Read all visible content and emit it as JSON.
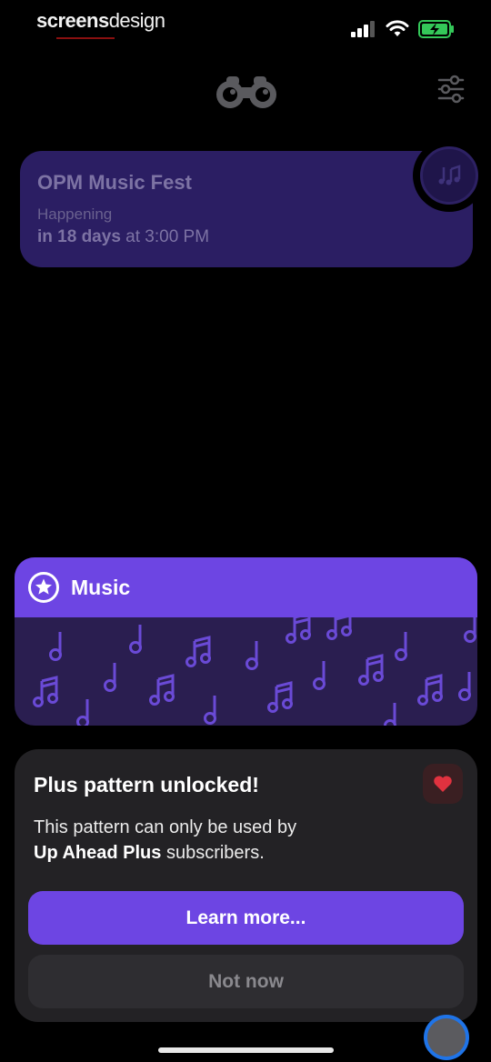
{
  "status_bar": {
    "brand_part1": "screens",
    "brand_part2": "design",
    "icons": [
      "cellular-signal-icon",
      "wifi-icon",
      "battery-charging-icon"
    ],
    "battery_color": "#34c759"
  },
  "header": {
    "left_icon": "binoculars-icon",
    "right_icon": "sliders-filter-icon"
  },
  "event_card": {
    "title": "OPM Music Fest",
    "status_label": "Happening",
    "when_bold": "in 18 days",
    "when_rest": " at 3:00 PM",
    "badge_icon": "music-notes-icon",
    "color": "#2b1e63"
  },
  "pattern_card": {
    "title": "Music",
    "icon": "star-circle-icon",
    "accent": "#6d45e3"
  },
  "sheet": {
    "title": "Plus pattern unlocked!",
    "body_line1": "This pattern can only be used by",
    "body_bold": "Up Ahead Plus",
    "body_rest": " subscribers.",
    "heart_icon": "heart-icon",
    "primary_button": "Learn more...",
    "secondary_button": "Not now"
  },
  "colors": {
    "background": "#000000",
    "accent": "#6d45e3",
    "sheet_bg": "#232225",
    "heart": "#e0323f"
  }
}
